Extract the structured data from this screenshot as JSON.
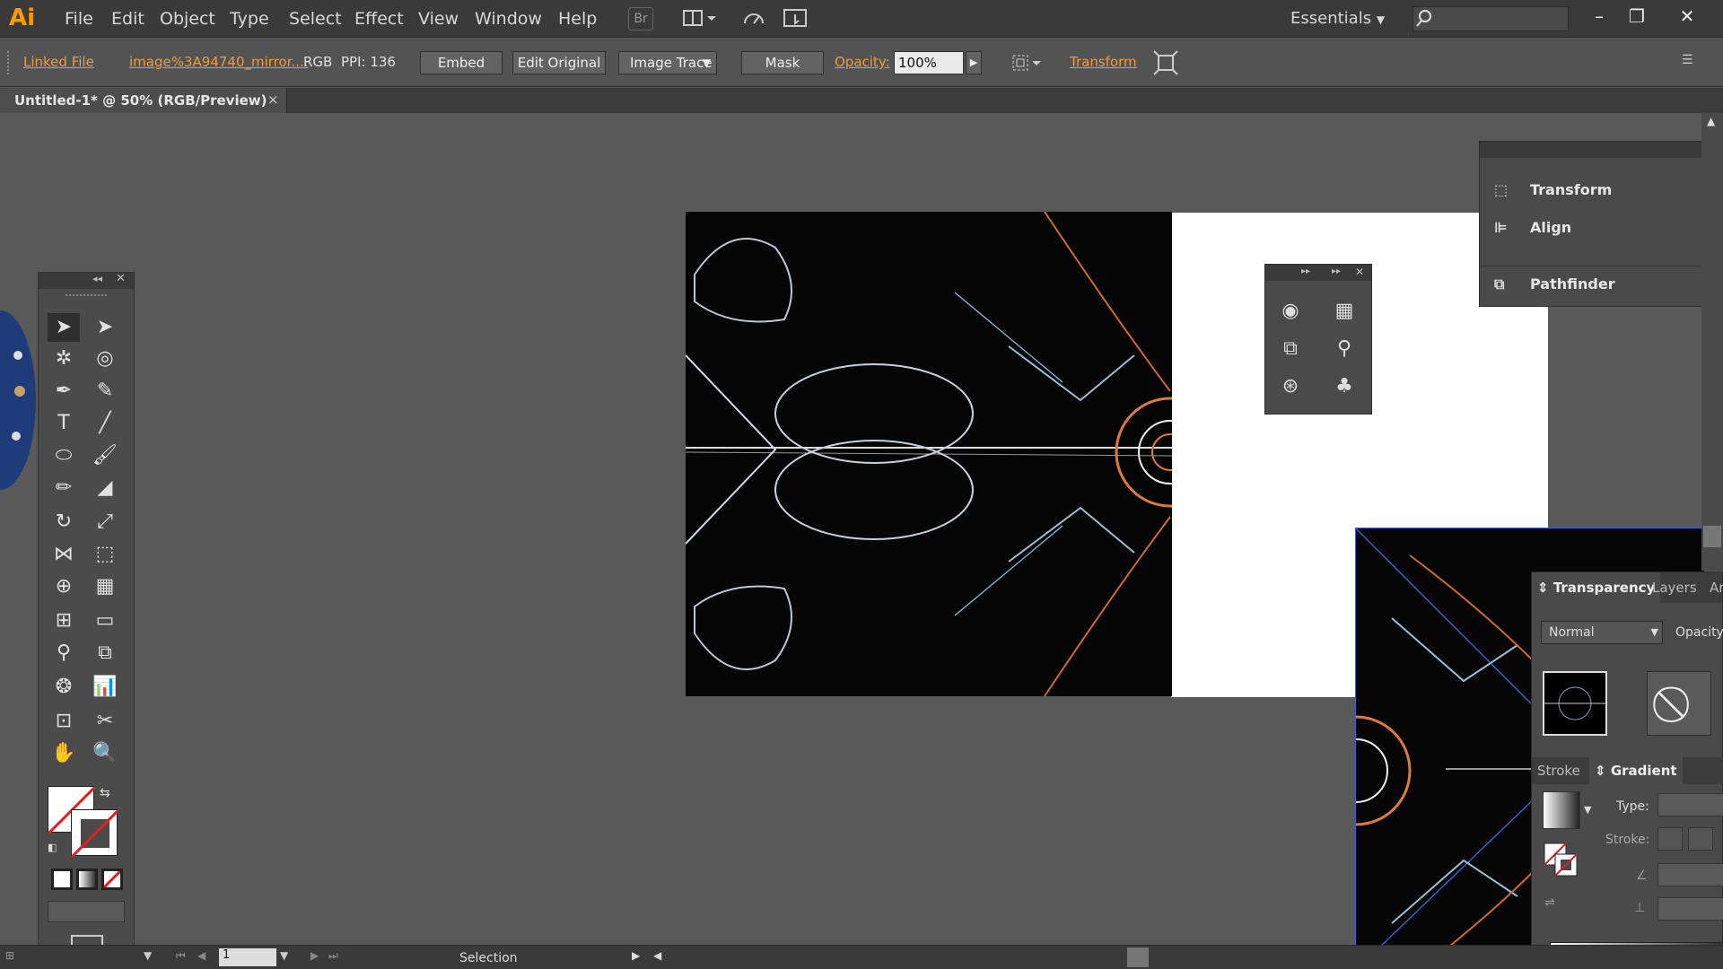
{
  "app": {
    "logo": "Ai"
  },
  "menu": [
    "File",
    "Edit",
    "Object",
    "Type",
    "Select",
    "Effect",
    "View",
    "Window",
    "Help"
  ],
  "toolbar_icons": {
    "bridge": "Br"
  },
  "workspace": {
    "label": "Essentials"
  },
  "window_controls": {
    "minimize": "minimize-icon",
    "restore": "restore-icon",
    "close": "close-icon"
  },
  "control_bar": {
    "linked_file": "Linked File",
    "file_name": "image%3A94740_mirror....",
    "color_mode": "RGB",
    "ppi": "PPI: 136",
    "embed": "Embed",
    "edit_original": "Edit Original",
    "image_trace": "Image Trace",
    "mask": "Mask",
    "opacity_label": "Opacity:",
    "opacity_value": "100%",
    "transform": "Transform"
  },
  "document": {
    "tab_title": "Untitled-1* @ 50% (RGB/Preview)",
    "close": "×"
  },
  "status": {
    "page": "1",
    "mode": "Selection"
  },
  "right_panel": {
    "items": [
      "Transform",
      "Align",
      "Pathfinder"
    ]
  },
  "transparency_panel": {
    "tabs": [
      "Transparency",
      "Layers",
      "Ar"
    ],
    "blend_mode": "Normal",
    "opacity_label": "Opacity:",
    "sub_tabs": [
      "Stroke",
      "Gradient"
    ],
    "type_label": "Type:",
    "stroke_label": "Stroke:"
  },
  "colors": {
    "accent": "#f19a3b",
    "panel": "#4a4a4a",
    "canvas": "#595959",
    "selection": "#3a5fcf"
  }
}
